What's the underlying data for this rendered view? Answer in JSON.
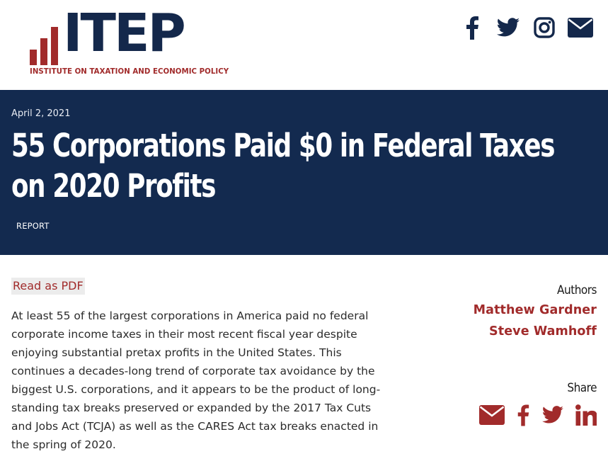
{
  "header": {
    "logo_text": "ITEP",
    "logo_subtitle": "INSTITUTE ON TAXATION AND ECONOMIC POLICY",
    "social_icons": [
      "facebook-icon",
      "twitter-icon",
      "instagram-icon",
      "email-icon"
    ]
  },
  "hero": {
    "date": "April 2, 2021",
    "title": "55 Corporations Paid $0 in Federal Taxes on 2020 Profits",
    "tag": "REPORT"
  },
  "main": {
    "pdf_link": "Read as PDF",
    "paragraph": "At least 55 of the largest corporations in America paid no federal corporate income taxes in their most recent fiscal year despite enjoying substantial pretax profits in the United States. This continues a decades-long trend of corporate tax avoidance by the biggest U.S. corporations, and it appears to be the product of long-standing tax breaks preserved or expanded by the 2017 Tax Cuts and Jobs Act (TCJA) as well as the CARES Act tax breaks enacted in the spring of 2020."
  },
  "sidebar": {
    "authors_heading": "Authors",
    "authors": [
      "Matthew Gardner",
      "Steve Wamhoff"
    ],
    "share_heading": "Share",
    "share_icons": [
      "email-icon",
      "facebook-icon",
      "twitter-icon",
      "linkedin-icon"
    ]
  },
  "colors": {
    "navy": "#132a4f",
    "brand_red": "#a12b2b",
    "logo_navy": "#14284b"
  }
}
